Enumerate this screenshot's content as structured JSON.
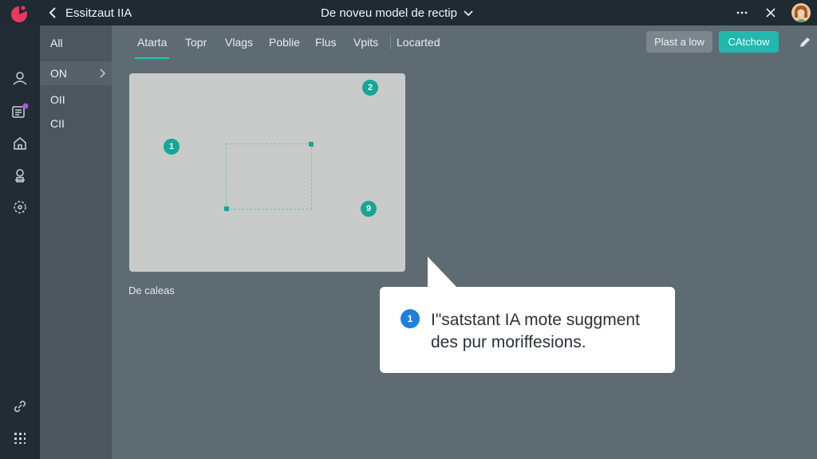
{
  "topbar": {
    "app_title": "Essitzaut IIA",
    "doc_title": "De noveu model de rectip",
    "icons": [
      "logo-icon",
      "back-chevron-icon",
      "chevron-down-icon",
      "more-icon",
      "close-icon",
      "avatar"
    ]
  },
  "rail": {
    "icons": [
      "user-icon",
      "notes-icon",
      "home-icon",
      "profile-stamp-icon",
      "settings-dashed-icon",
      "link-icon",
      "grid-icon"
    ],
    "notification_color": "#a45cd6"
  },
  "panel": {
    "items": [
      {
        "label": "All"
      },
      {
        "label": "ON"
      },
      {
        "label": "OII"
      },
      {
        "label": "CII"
      }
    ]
  },
  "tabs": [
    {
      "label": "Atarta"
    },
    {
      "label": "Topr"
    },
    {
      "label": "Vlags"
    },
    {
      "label": "Poblie"
    },
    {
      "label": "Flus"
    },
    {
      "label": "Vpits"
    },
    {
      "label": "Locarted"
    }
  ],
  "toolbar": {
    "plast_label": "Plast a low",
    "catch_label": "CAtchow"
  },
  "canvas": {
    "markers": [
      {
        "label": "1"
      },
      {
        "label": "2"
      },
      {
        "label": "9"
      }
    ],
    "caption": "De caleas"
  },
  "tooltip": {
    "badge": "1",
    "line1": "I\"satstant IA mote suggment",
    "line2": "des pur moriffesions."
  },
  "colors": {
    "accent": "#21b9ad",
    "marker": "#17a595",
    "info_badge": "#1e7fdc",
    "logo": "#e53a5e"
  }
}
